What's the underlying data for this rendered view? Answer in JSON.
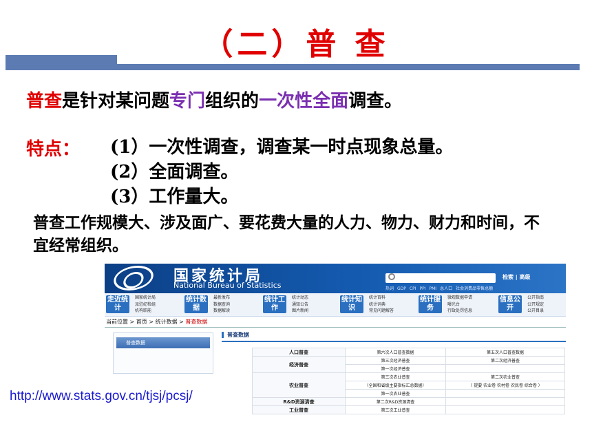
{
  "title": "（二）普 查",
  "definition": {
    "term": "普查",
    "part1": "是针对某问题",
    "special": "专门",
    "part2": "组织的",
    "comprehensive": "一次性全面",
    "part3": "调查。"
  },
  "features": {
    "label": "特点：",
    "items": [
      "(1）一次性调查，调查某一时点现象总量。",
      "(2）全面调查。",
      "(3）工作量大。"
    ]
  },
  "note": "普查工作规模大、涉及面广、要花费大量的人力、物力、财力和时间，不宜经常组织。",
  "url": "http://www.stats.gov.cn/tjsj/pcsj/",
  "colors": {
    "accent_red": "#e00000",
    "accent_purple": "#7a2fb0",
    "title_bar": "#5b7bb2",
    "site_blue": "#145bb0"
  },
  "website": {
    "name_cn": "国家统计局",
    "name_en": "National Bureau of Statistics",
    "search_button": "检索 | 高级",
    "hot_words": [
      "热词",
      "GDP",
      "CPI",
      "PPI",
      "PMI",
      "总人口",
      "社会消费品零售总额"
    ],
    "nav": [
      {
        "button": "走近统计",
        "links": [
          "国家统计局",
          "派驻纪检组",
          "机构职能"
        ]
      },
      {
        "button": "统计数据",
        "links": [
          "最新发布",
          "数据查询",
          "数据解读"
        ]
      },
      {
        "button": "统计工作",
        "links": [
          "统计动态",
          "通知公告",
          "图片新闻"
        ]
      },
      {
        "button": "统计知识",
        "links": [
          "统计百科",
          "统计词典",
          "常见问题解答"
        ]
      },
      {
        "button": "统计服务",
        "links": [
          "微观数据申请",
          "曝光台",
          "行政处罚信息"
        ]
      },
      {
        "button": "信息公开",
        "links": [
          "公开指南",
          "公开规定",
          "公开目录"
        ]
      }
    ],
    "breadcrumb": {
      "prefix": "当前位置",
      "items": [
        "首页",
        "统计数据"
      ],
      "current": "普查数据",
      "sep": ">"
    },
    "sidebar_tab": "普查数据",
    "main_heading": "普查数据",
    "table": {
      "population": {
        "category": "人口普查",
        "cells": [
          "第六次人口普查数据",
          "第五次人口普查数据"
        ]
      },
      "economic": {
        "category": "经济普查",
        "rows": [
          [
            "第三次经济普查",
            "第二次经济普查"
          ],
          [
            "第一次经济普查",
            ""
          ]
        ]
      },
      "agriculture": {
        "category": "农业普查",
        "rows": [
          [
            "第三次农业普查",
            "第二次农业普查"
          ],
          [
            "（全国和省级主要指标汇总数据）",
            "（ 提要  农业卷  农村卷  农民卷  综合卷 ）"
          ],
          [
            "第一次农业普查",
            ""
          ]
        ]
      },
      "rd": {
        "category": "R&D资源清查",
        "cells": [
          "第二次R&D资源清查",
          ""
        ]
      },
      "industry": {
        "category": "工业普查",
        "cells": [
          "第三次工业普查",
          ""
        ]
      }
    }
  }
}
